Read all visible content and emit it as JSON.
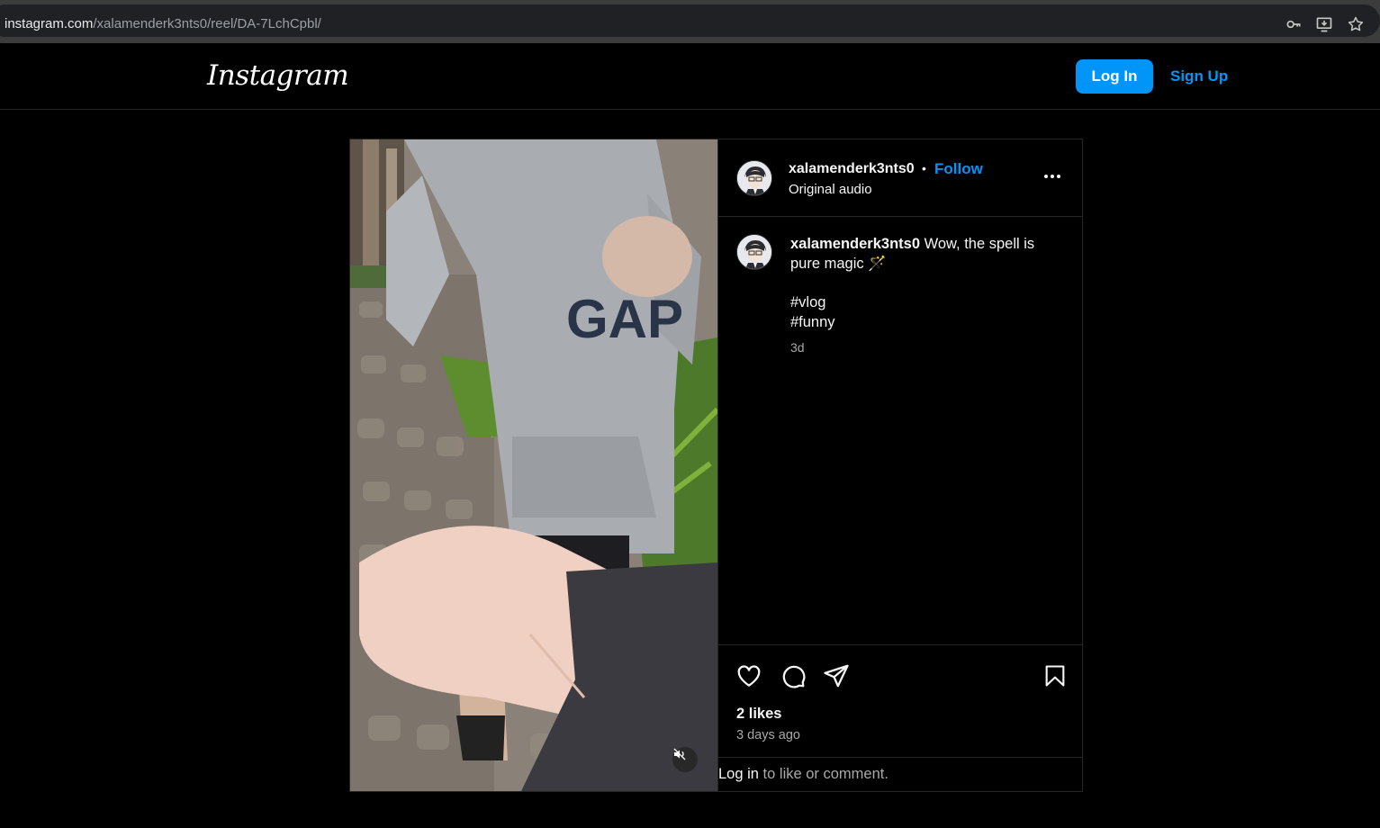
{
  "browser": {
    "url_host": "instagram.com",
    "url_path": "/xalamenderk3nts0/reel/DA-7LchCpbl/",
    "icons": [
      "key-icon",
      "install-app-icon",
      "bookmark-star-icon"
    ]
  },
  "header": {
    "logo_text": "Instagram",
    "login_label": "Log In",
    "signup_label": "Sign Up"
  },
  "post": {
    "username": "xalamenderk3nts0",
    "separator": "•",
    "follow_label": "Follow",
    "audio_label": "Original audio",
    "caption_text": "Wow, the spell is pure magic",
    "caption_emoji": "🪄",
    "hashtags": [
      "#vlog",
      "#funny"
    ],
    "caption_time": "3d",
    "likes": "2 likes",
    "posted_ago": "3 days ago",
    "login_prompt": {
      "link": "Log in",
      "rest": " to like or comment."
    }
  },
  "colors": {
    "accent": "#0095f6",
    "background": "#000000",
    "border": "#262626",
    "muted_text": "#a8a8a8"
  }
}
